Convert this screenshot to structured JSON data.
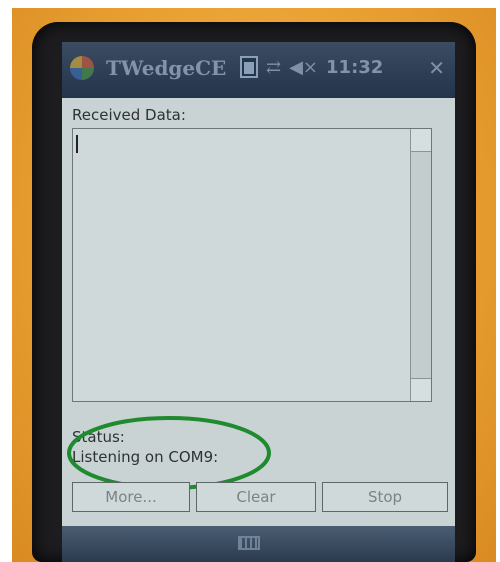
{
  "window": {
    "title": "TWedgeCE",
    "clock": "11:32",
    "icons": {
      "start": "windows-start-icon",
      "battery": "battery-icon",
      "connectivity": "connectivity-icon",
      "volume": "speaker-mute-icon",
      "close": "close-icon"
    }
  },
  "main": {
    "received_label": "Received Data:",
    "received_value": "",
    "status_label": "Status:",
    "status_text": "Listening on COM9:"
  },
  "buttons": {
    "more": "More...",
    "clear": "Clear",
    "stop": "Stop"
  },
  "taskbar": {
    "keyboard_icon": "keyboard-icon"
  },
  "colors": {
    "device_orange": "#e9a032",
    "annotation_green": "#1f8a2e",
    "titlebar": "#2b3b52"
  }
}
